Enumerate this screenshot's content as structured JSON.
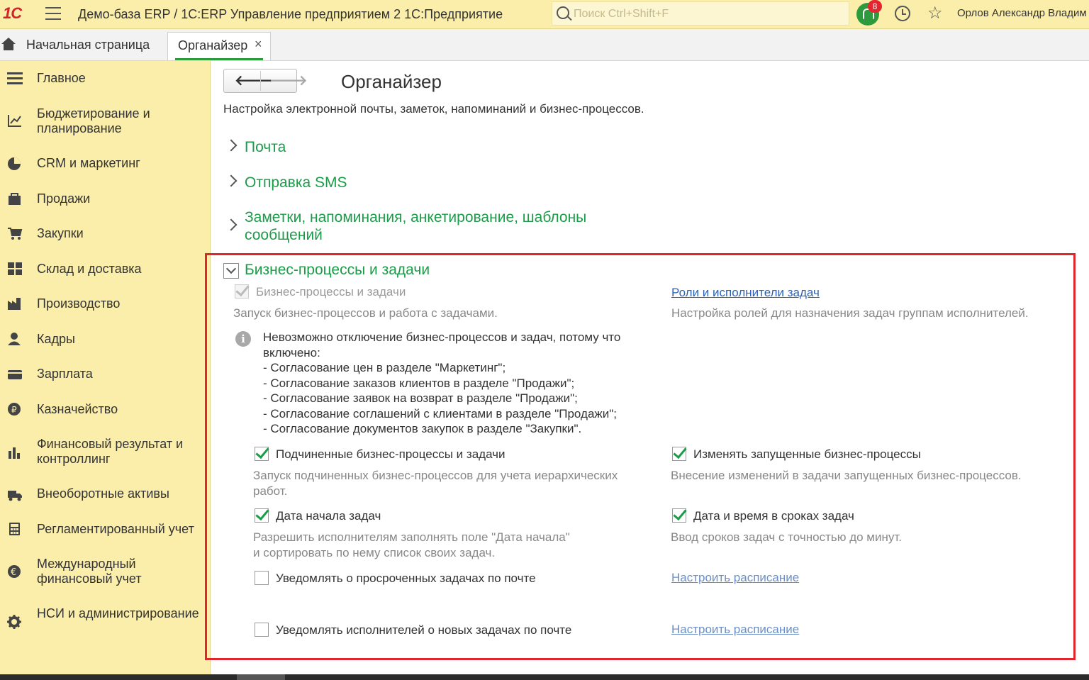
{
  "header": {
    "logo": "1С",
    "app_title": "Демо-база ERP / 1С:ERP Управление предприятием 2 1С:Предприятие",
    "search_placeholder": "Поиск Ctrl+Shift+F",
    "notifications_count": "8",
    "user_name": "Орлов Александр Владим"
  },
  "tabs": {
    "home": "Начальная страница",
    "active": "Органайзер",
    "close": "×"
  },
  "sidebar": {
    "items": [
      {
        "label": "Главное",
        "icon": "menu-lines-icon"
      },
      {
        "label": "Бюджетирование и планирование",
        "icon": "budget-chart-icon"
      },
      {
        "label": "CRM и маркетинг",
        "icon": "pie-chart-icon"
      },
      {
        "label": "Продажи",
        "icon": "bag-icon"
      },
      {
        "label": "Закупки",
        "icon": "cart-icon"
      },
      {
        "label": "Склад и доставка",
        "icon": "warehouse-grid-icon"
      },
      {
        "label": "Производство",
        "icon": "factory-icon"
      },
      {
        "label": "Кадры",
        "icon": "person-icon"
      },
      {
        "label": "Зарплата",
        "icon": "wallet-icon"
      },
      {
        "label": "Казначейство",
        "icon": "coin-icon"
      },
      {
        "label": "Финансовый результат и контроллинг",
        "icon": "bar-chart-icon"
      },
      {
        "label": "Внеоборотные активы",
        "icon": "truck-icon"
      },
      {
        "label": "Регламентированный учет",
        "icon": "calculator-icon"
      },
      {
        "label": "Международный финансовый учет",
        "icon": "euro-icon"
      },
      {
        "label": "НСИ и администрирование",
        "icon": "gear-icon"
      }
    ]
  },
  "content": {
    "nav_back": "🡐",
    "nav_forward": "🡒",
    "title": "Органайзер",
    "description": "Настройка электронной почты, заметок, напоминаний и бизнес-процессов.",
    "sections": [
      "Почта",
      "Отправка SMS",
      "Заметки, напоминания, анкетирование, шаблоны сообщений"
    ],
    "open_section": {
      "title": "Бизнес-процессы и задачи",
      "main_checkbox": {
        "label": "Бизнес-процессы и задачи",
        "checked": true,
        "disabled": true
      },
      "main_desc": "Запуск бизнес-процессов и работа с задачами.",
      "roles_link": "Роли и исполнители задач",
      "roles_desc": "Настройка ролей для назначения задач группам исполнителей.",
      "info_lines": [
        "Невозможно отключение бизнес-процессов и задач, потому что",
        "включено:",
        "- Согласование цен в разделе \"Маркетинг\";",
        "- Согласование заказов клиентов в разделе \"Продажи\";",
        "- Согласование заявок на возврат в разделе \"Продажи\";",
        "- Согласование соглашений с клиентами в разделе \"Продажи\";",
        "- Согласование документов закупок в разделе \"Закупки\"."
      ],
      "options": {
        "subordinate": {
          "label": "Подчиненные бизнес-процессы и задачи",
          "checked": true,
          "desc1": "Запуск подчиненных бизнес-процессов для учета иерархических",
          "desc2": "работ."
        },
        "change_running": {
          "label": "Изменять запущенные бизнес-процессы",
          "checked": true,
          "desc": "Внесение изменений в задачи запущенных бизнес-процессов."
        },
        "start_date": {
          "label": "Дата начала задач",
          "checked": true,
          "desc1": "Разрешить исполнителям заполнять поле \"Дата начала\"",
          "desc2": "и сортировать по нему список своих задач."
        },
        "date_time": {
          "label": "Дата и время в сроках задач",
          "checked": true,
          "desc": "Ввод сроков задач с точностью до минут."
        },
        "notify_overdue": {
          "label": "Уведомлять о просроченных задачах по почте",
          "checked": false,
          "link": "Настроить расписание"
        },
        "notify_new": {
          "label": "Уведомлять исполнителей о новых задачах по почте",
          "checked": false,
          "link": "Настроить расписание"
        }
      }
    }
  },
  "colors": {
    "header_bg": "#fbeeaa",
    "accent_green": "#1a9c48",
    "link_blue": "#2a64b8",
    "highlight_red": "#e0262c",
    "badge_red": "#e3262f"
  }
}
